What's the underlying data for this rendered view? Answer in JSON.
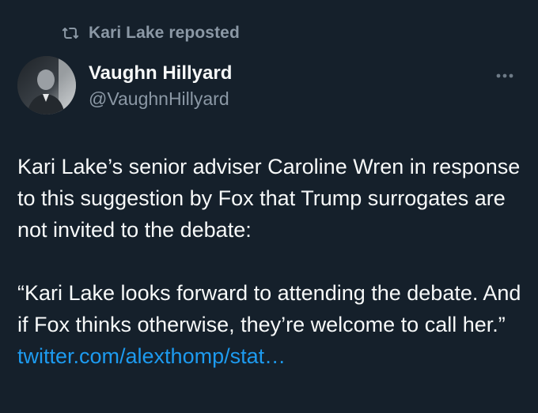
{
  "repost": {
    "label": "Kari Lake reposted",
    "icon": "repost-icon"
  },
  "author": {
    "display_name": "Vaughn Hillyard",
    "handle": "@VaughnHillyard",
    "avatar": "avatar-photo"
  },
  "menu": {
    "icon": "more-icon"
  },
  "tweet": {
    "paragraph_1": "Kari Lake’s senior adviser Caroline Wren in response to this suggestion by Fox that Trump surrogates are not invited to the debate:",
    "paragraph_2": "“Kari Lake looks forward to attending the debate. And if Fox thinks otherwise, they’re welcome to call her.”",
    "link": "twitter.com/alexthomp/stat…"
  },
  "colors": {
    "background": "#15202b",
    "text_primary": "#f7f9f9",
    "text_secondary": "#8b98a5",
    "link": "#1d9bf0"
  }
}
